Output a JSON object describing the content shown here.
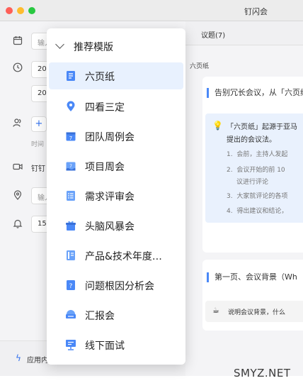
{
  "window": {
    "title": "钉闪会"
  },
  "form": {
    "input1_placeholder": "输入",
    "date1": "202",
    "date2": "202",
    "add_icon": "plus-icon",
    "time_label": "时间",
    "dingtalk_label": "钉钉",
    "location_placeholder": "输入",
    "reminder_value": "15",
    "bottom_text": "应用内"
  },
  "main": {
    "tab_label": "议题(7)",
    "doc_title": "六页纸",
    "section1_title": "告别冗长会议，从「六页纸",
    "callout_line1": "「六页纸」起源于亚马",
    "callout_line2": "提出的会议法。",
    "list": [
      {
        "num": "1.",
        "text": "会前，主持人发起"
      },
      {
        "num": "2.",
        "text": "会议开始的前 10"
      },
      {
        "num": "",
        "text": "议进行评论"
      },
      {
        "num": "3.",
        "text": "大家就评论的各项"
      },
      {
        "num": "4.",
        "text": "得出建议和结论，"
      }
    ],
    "section2_title": "第一页、会议背景（Wh",
    "section2_callout": "说明会议背景，什么"
  },
  "dropdown": {
    "header": "推荐模版",
    "items": [
      {
        "label": "六页纸",
        "icon": "document-icon",
        "selected": true
      },
      {
        "label": "四看三定",
        "icon": "map-pin-icon",
        "selected": false
      },
      {
        "label": "团队周例会",
        "icon": "calendar-icon",
        "selected": false
      },
      {
        "label": "项目周会",
        "icon": "wave-calendar-icon",
        "selected": false
      },
      {
        "label": "需求评审会",
        "icon": "checklist-icon",
        "selected": false
      },
      {
        "label": "头脑风暴会",
        "icon": "gift-box-icon",
        "selected": false
      },
      {
        "label": "产品&技术年度…",
        "icon": "report-icon",
        "selected": false
      },
      {
        "label": "问题根因分析会",
        "icon": "question-doc-icon",
        "selected": false
      },
      {
        "label": "汇报会",
        "icon": "presentation-icon",
        "selected": false
      },
      {
        "label": "线下面试",
        "icon": "board-icon",
        "selected": false
      }
    ]
  },
  "watermark": "SMYZ.NET",
  "colors": {
    "accent": "#2f6fed",
    "selected_bg": "#e8f1fe",
    "icon_blue": "#4a88f7"
  }
}
